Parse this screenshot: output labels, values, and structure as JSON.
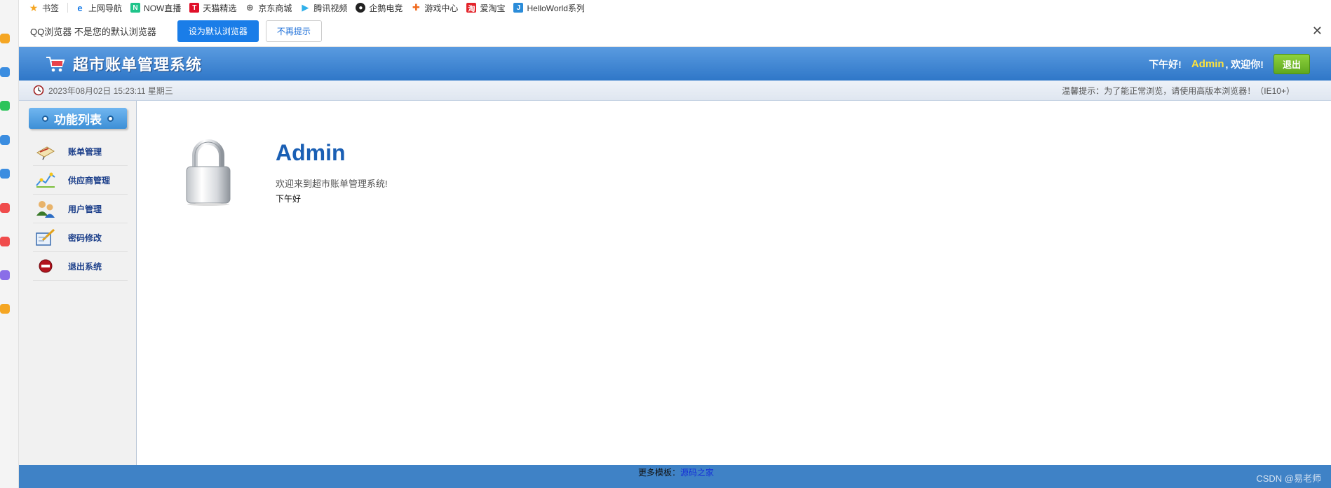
{
  "bookmarks": [
    {
      "label": "书签",
      "icon": "star-icon",
      "color": "#f5a623"
    },
    {
      "label": "上网导航",
      "icon": "ie-icon",
      "color": "#1a7de8"
    },
    {
      "label": "NOW直播",
      "icon": "now-icon",
      "color": "#1fc48a"
    },
    {
      "label": "天猫精选",
      "icon": "tmall-icon",
      "color": "#e0102a"
    },
    {
      "label": "京东商城",
      "icon": "globe-icon",
      "color": "#666666"
    },
    {
      "label": "腾讯视频",
      "icon": "play-icon",
      "color": "#2fb0ea"
    },
    {
      "label": "企鹅电竞",
      "icon": "penguin-icon",
      "color": "#222222"
    },
    {
      "label": "游戏中心",
      "icon": "gamepad-icon",
      "color": "#f06a1e"
    },
    {
      "label": "爱淘宝",
      "icon": "taobao-icon",
      "color": "#e3242b"
    },
    {
      "label": "HelloWorld系列",
      "icon": "j-icon",
      "color": "#2b8cd9"
    }
  ],
  "notice": {
    "text": "QQ浏览器 不是您的默认浏览器",
    "set_default": "设为默认浏览器",
    "dismiss": "不再提示",
    "close": "✕"
  },
  "header": {
    "title": "超市账单管理系统",
    "greeting": "下午好!",
    "username": "Admin",
    "welcome": ", 欢迎你!",
    "logout": "退出"
  },
  "status": {
    "datetime": "2023年08月02日 15:23:11 星期三",
    "tip": "温馨提示：为了能正常浏览，请使用高版本浏览器！（IE10+）"
  },
  "sidebar": {
    "title": "功能列表",
    "items": [
      {
        "label": "账单管理",
        "icon": "bill-icon"
      },
      {
        "label": "供应商管理",
        "icon": "supplier-icon"
      },
      {
        "label": "用户管理",
        "icon": "users-icon"
      },
      {
        "label": "密码修改",
        "icon": "password-icon"
      },
      {
        "label": "退出系统",
        "icon": "exit-icon"
      }
    ]
  },
  "main": {
    "username": "Admin",
    "welcome": "欢迎来到超市账单管理系统!",
    "greeting": "下午好"
  },
  "footer": {
    "more_label": "更多模板：",
    "more_link": "源码之家",
    "watermark": "CSDN @易老师"
  },
  "colors": {
    "header": "#3f82c6",
    "accent_yellow": "#ffe33a",
    "logout_green": "#6cb82a",
    "link_blue": "#1a5fb4"
  }
}
